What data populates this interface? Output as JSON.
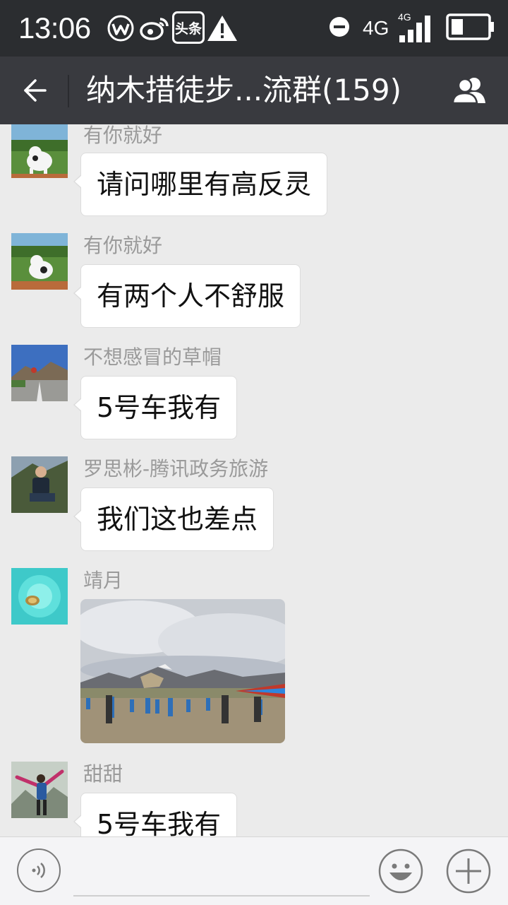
{
  "status_bar": {
    "time": "13:06",
    "toutiao_label": "头条",
    "network_label": "4G",
    "network_small_label": "4G",
    "icons": [
      "weibo-w-icon",
      "weibo-icon",
      "toutiao-icon",
      "warning-icon",
      "do-not-disturb-icon",
      "signal-icon",
      "battery-icon"
    ]
  },
  "header": {
    "title": "纳木措徒步...流群(159)",
    "back_icon": "back-arrow-icon",
    "members_icon": "group-members-icon"
  },
  "messages": [
    {
      "sender": "有你就好",
      "type": "text",
      "text": "请问哪里有高反灵",
      "avatar": "cow-garden-avatar"
    },
    {
      "sender": "有你就好",
      "type": "text",
      "text": "有两个人不舒服",
      "avatar": "cow-garden-avatar"
    },
    {
      "sender": "不想感冒的草帽",
      "type": "text",
      "text": "5号车我有",
      "avatar": "mountain-road-avatar"
    },
    {
      "sender": "罗思彬-腾讯政务旅游",
      "type": "text",
      "text": "我们这也差点",
      "avatar": "man-sitting-avatar"
    },
    {
      "sender": "靖月",
      "type": "image",
      "image": "plateau-group-photo",
      "avatar": "turtle-water-avatar"
    },
    {
      "sender": "甜甜",
      "type": "text",
      "text": "5号车我有",
      "avatar": "woman-arms-up-avatar"
    }
  ],
  "input_bar": {
    "placeholder": "",
    "icons": [
      "voice-icon",
      "emoji-icon",
      "plus-icon"
    ]
  },
  "colors": {
    "status_bar_bg": "#2b2d30",
    "nav_bg": "#393a3f",
    "chat_bg": "#ebebeb",
    "bubble_bg": "#ffffff",
    "sender_text": "#9a9a9a"
  }
}
